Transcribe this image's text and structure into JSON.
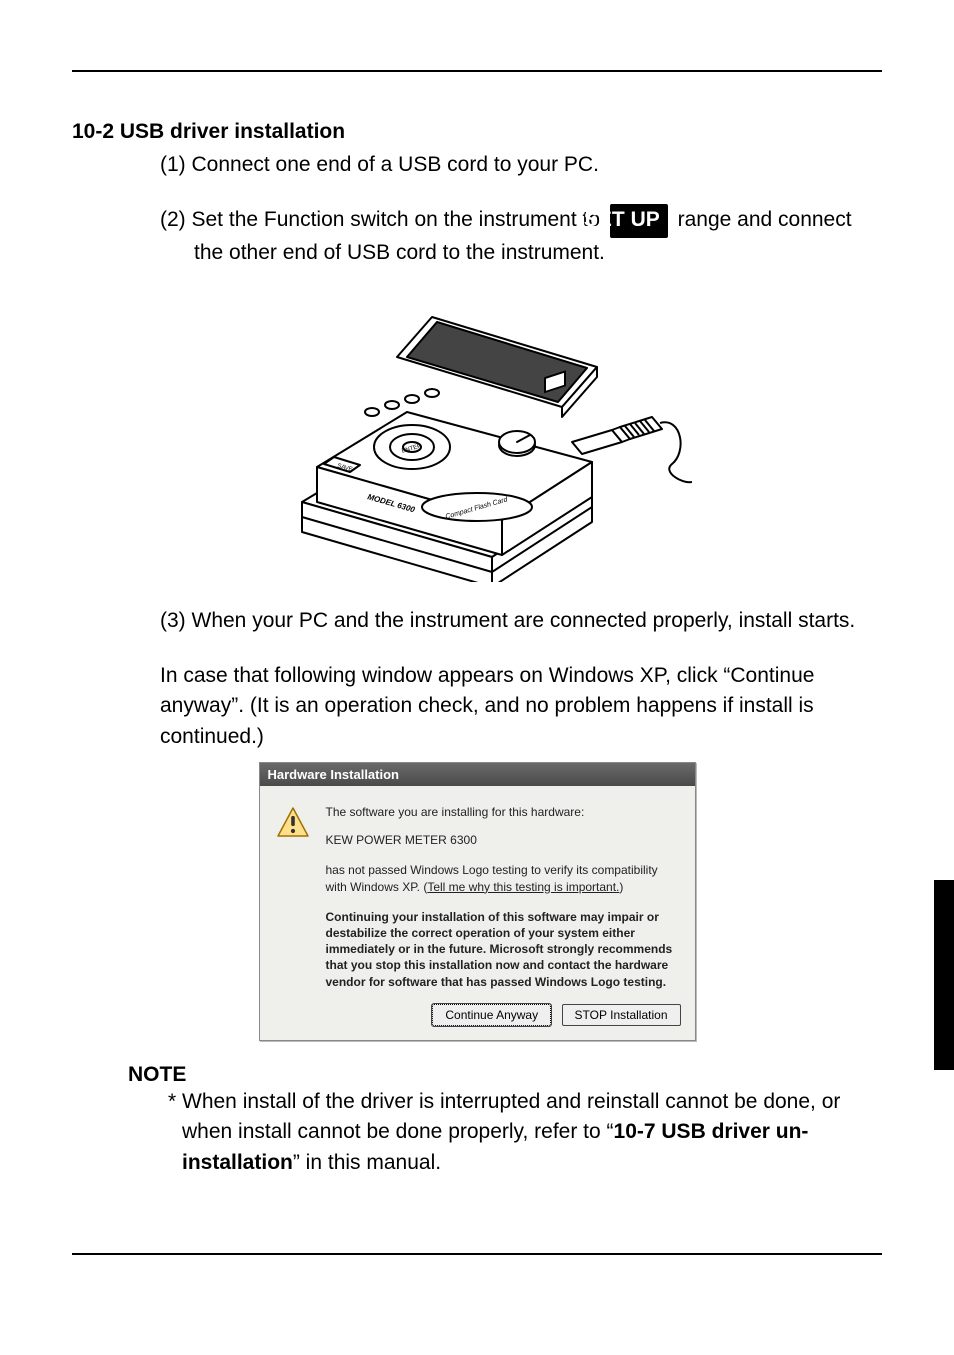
{
  "section_title": "10-2 USB driver installation",
  "steps": {
    "s1": "(1) Connect one end of a USB cord to your PC.",
    "s2_prefix": "(2) Set the Function switch on the instrument to",
    "s2_badge": "SET UP",
    "s2_suffix": "range and connect the other end of USB cord to the instrument.",
    "s3": "(3) When your PC and the instrument are connected properly, install starts."
  },
  "xp_para": "In case that following window appears on Windows XP, click “Continue anyway”. (It is an operation check, and no problem happens if install is continued.)",
  "dialog": {
    "title": "Hardware Installation",
    "line1": "The software you are installing for this hardware:",
    "device": "KEW POWER METER 6300",
    "line2a": "has not passed Windows Logo testing to verify its compatibility with Windows XP. (",
    "link": "Tell me why this testing is important.",
    "line2b": ")",
    "bold_block": "Continuing your installation of this software may impair or destabilize the correct operation of your system either immediately or in the future. Microsoft strongly recommends that you stop this installation now and contact the hardware vendor for software that has passed Windows Logo testing.",
    "btn_continue": "Continue Anyway",
    "btn_stop": "STOP Installation"
  },
  "note": {
    "title": "NOTE",
    "body_prefix": "* When install of the driver is interrupted and reinstall cannot be done, or when install cannot be done properly, refer to “",
    "ref_bold": "10-7 USB driver un-installation",
    "body_suffix": "” in this manual."
  },
  "icons": {
    "warning": "warning-icon",
    "device_illustration": "power-meter-usb-illustration"
  }
}
